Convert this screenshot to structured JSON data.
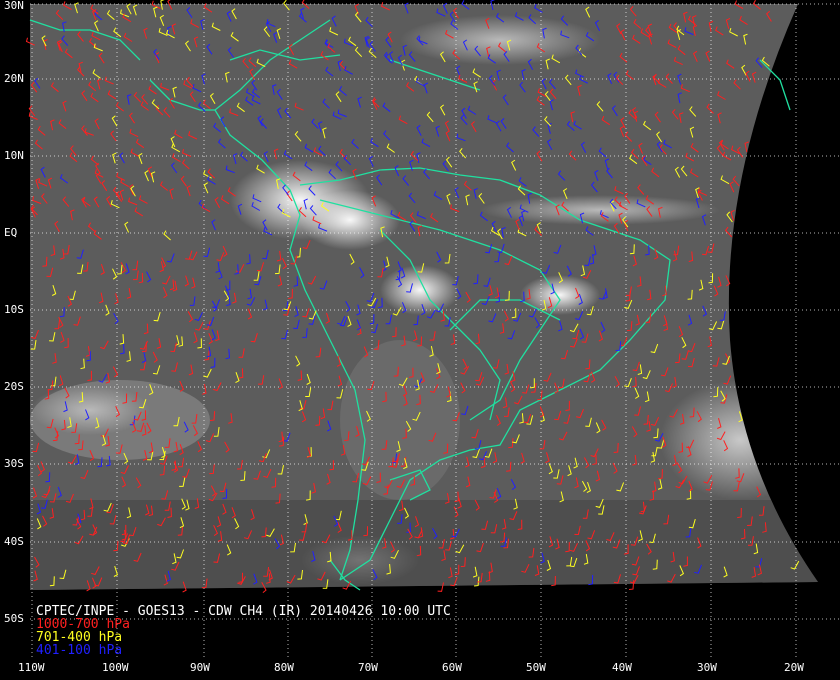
{
  "lat_labels": [
    "30N",
    "20N",
    "10N",
    "EQ",
    "10S",
    "20S",
    "30S",
    "40S",
    "50S"
  ],
  "lon_labels": [
    "110W",
    "100W",
    "90W",
    "80W",
    "70W",
    "60W",
    "50W",
    "40W",
    "30W",
    "20W"
  ],
  "caption": "CPTEC/INPE - GOES13 - CDW CH4 (IR) 20140426 10:00 UTC",
  "legend": [
    {
      "text": "1000-700 hPa",
      "color": "#ff2020"
    },
    {
      "text": "701-400 hPa",
      "color": "#ffff20"
    },
    {
      "text": "401-100 hPa",
      "color": "#2020ff"
    }
  ],
  "colors": {
    "coastline": "#20e0a0",
    "grid": "#ffffff",
    "background": "#000000"
  }
}
